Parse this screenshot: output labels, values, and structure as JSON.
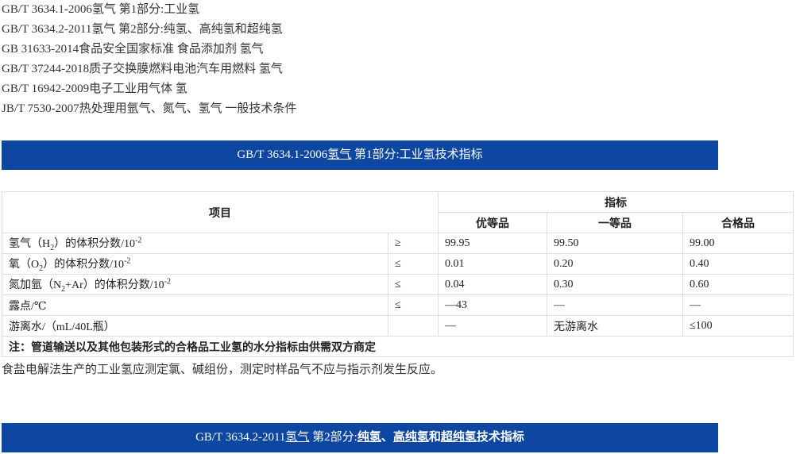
{
  "standards": [
    "GB/T 3634.1-2006氢气 第1部分:工业氢",
    "GB/T 3634.2-2011氢气 第2部分:纯氢、高纯氢和超纯氢",
    "GB 31633-2014食品安全国家标准 食品添加剂 氢气",
    "GB/T 37244-2018质子交换膜燃料电池汽车用燃料 氢气",
    "GB/T 16942-2009电子工业用气体 氢",
    "JB/T 7530-2007热处理用氩气、氮气、氢气 一般技术条件"
  ],
  "banner1": {
    "pre": "GB/T 3634.1-2006",
    "link": "氢气",
    "post": " 第1部分:工业氢技术指标"
  },
  "banner2": {
    "pre": "GB/T 3634.2-2011",
    "link": "氢气",
    "mid": " 第2部分:",
    "b1": "纯氢",
    "sep1": "、",
    "b2": "高纯氢",
    "b3": "和",
    "b4": "超纯氢",
    "b5": "技术指标"
  },
  "table": {
    "col_item": "项目",
    "col_spec": "指标",
    "grades": [
      "优等品",
      "一等品",
      "合格品"
    ],
    "rows": [
      {
        "a": "氢气（H",
        "sub": "2",
        "b": "）的体积分数/10",
        "sup": "-2",
        "op": "≥",
        "v": [
          "99.95",
          "99.50",
          "99.00"
        ]
      },
      {
        "a": "氧（O",
        "sub": "2",
        "b": "）的体积分数/10",
        "sup": "-2",
        "op": "≤",
        "v": [
          "0.01",
          "0.20",
          "0.40"
        ]
      },
      {
        "a": "氮加氩（N",
        "sub": "2",
        "b": "+Ar）的体积分数/10",
        "sup": "-2",
        "op": "≤",
        "v": [
          "0.04",
          "0.30",
          "0.60"
        ]
      },
      {
        "a": "露点/℃",
        "sub": "",
        "b": "",
        "sup": "",
        "op": "≤",
        "v": [
          "—43",
          "—",
          "—"
        ]
      },
      {
        "a": "游离水/（mL/40L瓶）",
        "sub": "",
        "b": "",
        "sup": "",
        "op": "",
        "v": [
          "—",
          "无游离水",
          "≤100"
        ]
      }
    ],
    "note": "注：管道输送以及其他包装形式的合格品工业氢的水分指标由供需双方商定"
  },
  "after_text": "食盐电解法生产的工业氢应测定氯、碱组份，测定时样品气不应与指示剂发生反应。",
  "colors": {
    "banner_bg": "#0d47a1",
    "banner_text": "#ffffff"
  }
}
